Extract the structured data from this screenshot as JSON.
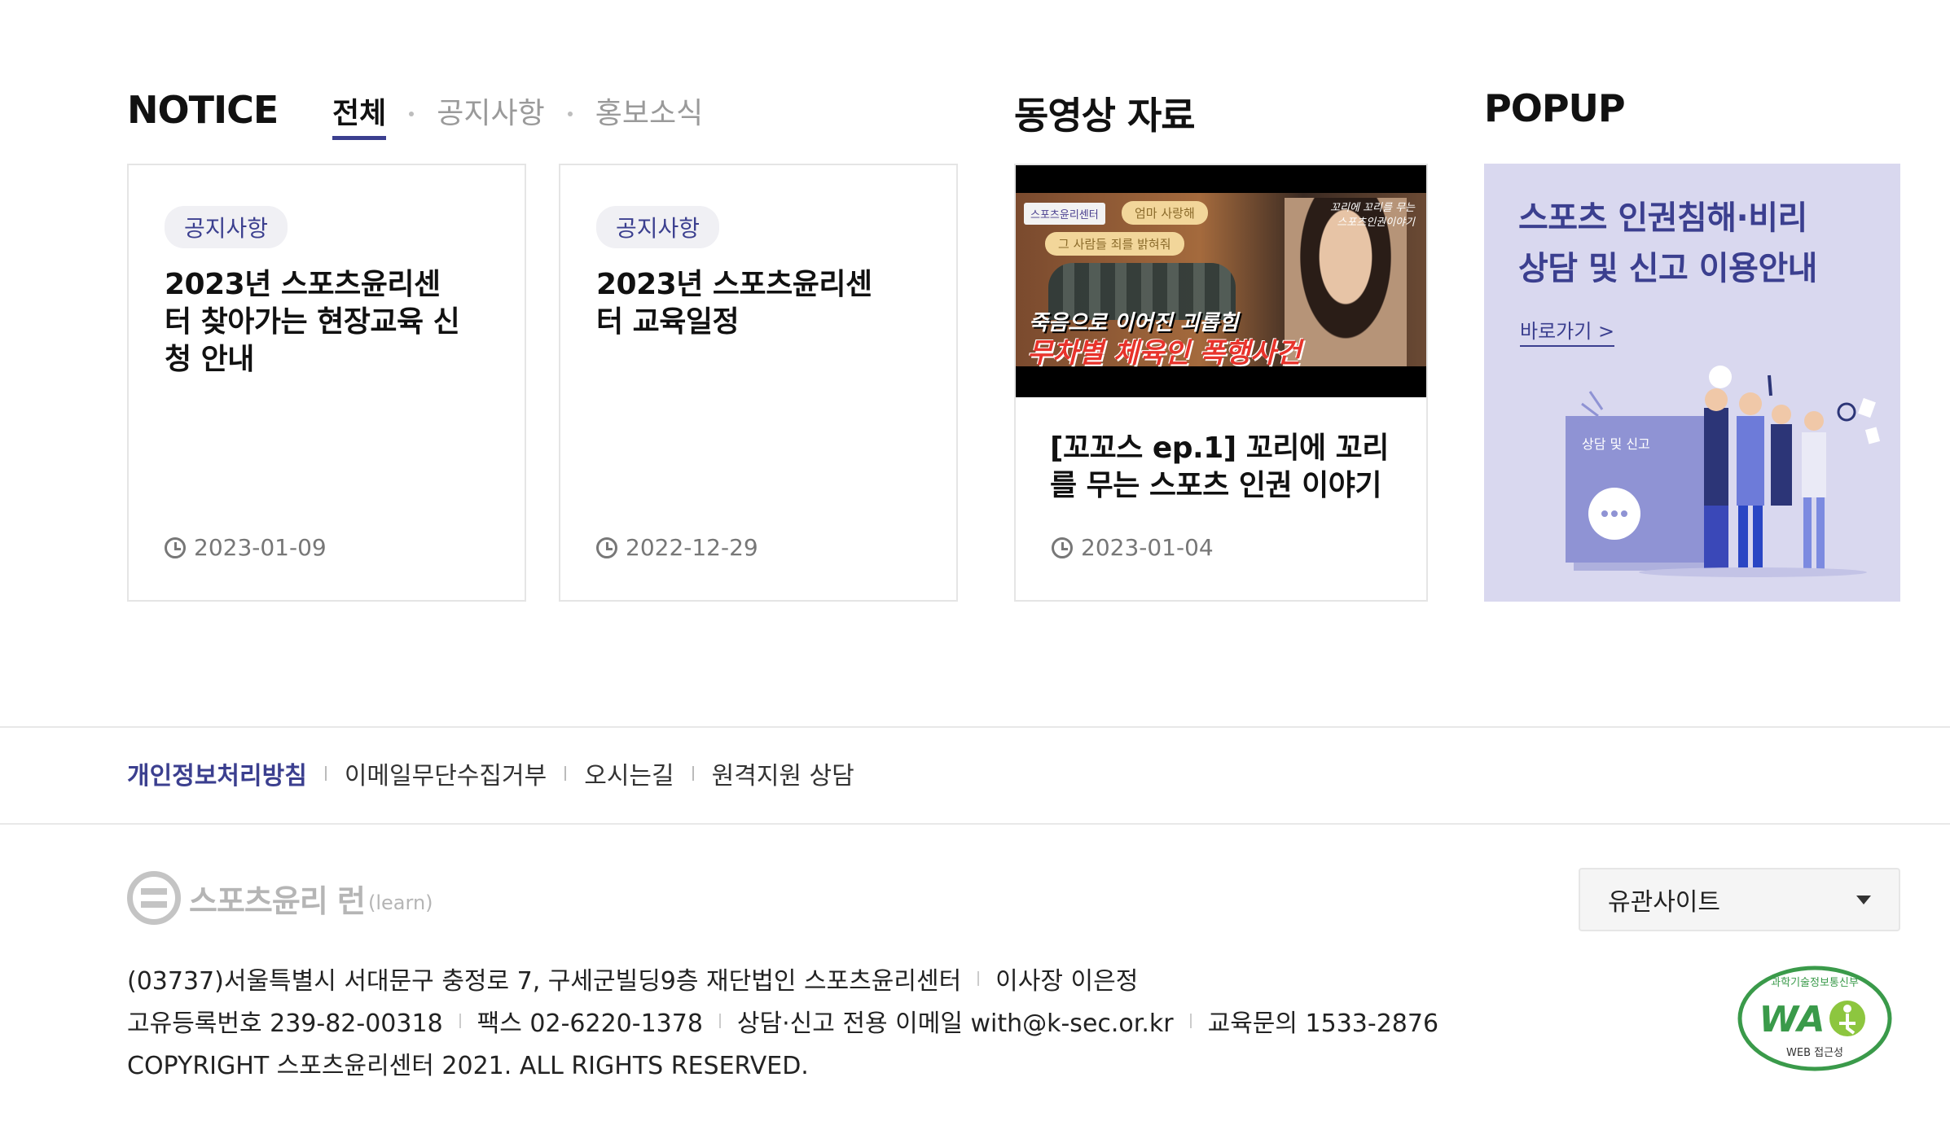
{
  "notice": {
    "title": "NOTICE",
    "tabs": [
      {
        "label": "전체",
        "active": true
      },
      {
        "label": "공지사항",
        "active": false
      },
      {
        "label": "홍보소식",
        "active": false
      }
    ],
    "cards": [
      {
        "badge": "공지사항",
        "title": "2023년 스포츠윤리센터 찾아가는 현장교육 신청 안내",
        "date": "2023-01-09"
      },
      {
        "badge": "공지사항",
        "title": "2023년 스포츠윤리센터 교육일정",
        "date": "2022-12-29"
      }
    ]
  },
  "video": {
    "title": "동영상 자료",
    "thumb": {
      "logo": "스포츠윤리센터",
      "bubble1": "엄마 사랑해",
      "bubble2": "그 사람들 죄를 밝혀줘",
      "sign": "꼬리에 꼬리를 무는 스포츠인권이야기",
      "line1": "죽음으로 이어진 괴롭힘",
      "line2": "무차별 체육인 폭행사건"
    },
    "card_title": "[꼬꼬스 ep.1] 꼬리에 꼬리를 무는 스포츠 인권 이야기",
    "date": "2023-01-04"
  },
  "popup": {
    "title": "POPUP",
    "banner_title_1": "스포츠 인권침해·비리",
    "banner_title_2": "상담 및 신고 이용안내",
    "link": "바로가기 >",
    "illus_label": "상담 및 신고"
  },
  "footer": {
    "links": [
      {
        "label": "개인정보처리방침",
        "strong": true
      },
      {
        "label": "이메일무단수집거부",
        "strong": false
      },
      {
        "label": "오시는길",
        "strong": false
      },
      {
        "label": "원격지원 상담",
        "strong": false
      }
    ],
    "logo_text": "스포츠윤리 런",
    "logo_sub": "(learn)",
    "related_sites": "유관사이트",
    "address": "(03737)서울특별시 서대문구 충정로 7, 구세군빌딩9층 재단법인 스포츠윤리센터",
    "ceo": "이사장 이은정",
    "reg_no": "고유등록번호 239-82-00318",
    "fax": "팩스 02-6220-1378",
    "email": "상담·신고 전용 이메일 with@k-sec.or.kr",
    "edu": "교육문의 1533-2876",
    "copyright": "COPYRIGHT 스포츠윤리센터 2021. ALL RIGHTS RESERVED.",
    "wa_top": "과학기술정보통신부",
    "wa_mark": "WA",
    "wa_bottom": "WEB 접근성"
  },
  "colors": {
    "accent": "#3b3f8f",
    "popup_bg": "#d9d8ef",
    "video_red": "#e8332b"
  }
}
